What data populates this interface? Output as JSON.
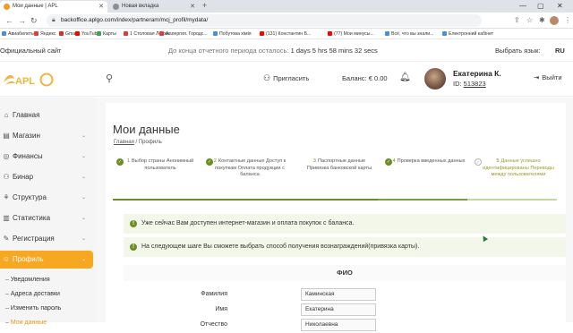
{
  "browser": {
    "tabs": [
      {
        "title": "Мои данные | APL",
        "active": true
      },
      {
        "title": "Новая вкладка",
        "active": false
      }
    ],
    "url": "backoffice.aplgo.com/index/partneram/mcj_profil/mydata/",
    "bookmarks": [
      {
        "label": "Авиабилеты",
        "color": "#4a90d9"
      },
      {
        "label": "Яндекс",
        "color": "#e53935"
      },
      {
        "label": "Gmail",
        "color": "#d93025"
      },
      {
        "label": "YouTube",
        "color": "#ff0000"
      },
      {
        "label": "Карты",
        "color": "#34a853"
      },
      {
        "label": "1 Столовая Ложка...",
        "color": "#e53935"
      },
      {
        "label": "Аллергия. Городс...",
        "color": "#e53935"
      },
      {
        "label": "Побутова хімія",
        "color": "#4a90d9"
      },
      {
        "label": "(131) Константин Б...",
        "color": "#ff0000"
      },
      {
        "label": "(77) Мои минусы...",
        "color": "#ff0000"
      },
      {
        "label": "Всё, что вы знали...",
        "color": "#4a90d9"
      },
      {
        "label": "Електронний кабінет",
        "color": "#4a90d9"
      }
    ]
  },
  "topstrip": {
    "official": "Официальный сайт",
    "countdown_prefix": "До конца отчетного периода осталось: ",
    "countdown_value": "1 days 5 hrs 58 mins 32 secs",
    "lang_label": "Выбрать язык:",
    "lang_value": "RU"
  },
  "header": {
    "logo_text": "APLGO",
    "invite": "Пригласить",
    "balance": "Баланс: € 0.00",
    "user_name": "Екатерина К.",
    "user_id_label": "ID: ",
    "user_id": "513823",
    "logout": "Выйти"
  },
  "sidebar": {
    "items": [
      {
        "label": "Главная",
        "icon": "home-icon",
        "glyph": "⌂",
        "chevron": false
      },
      {
        "label": "Магазин",
        "icon": "shop-icon",
        "glyph": "▤",
        "chevron": true
      },
      {
        "label": "Финансы",
        "icon": "finance-icon",
        "glyph": "◎",
        "chevron": true
      },
      {
        "label": "Бинар",
        "icon": "binar-icon",
        "glyph": "⚇",
        "chevron": true
      },
      {
        "label": "Структура",
        "icon": "structure-icon",
        "glyph": "⚘",
        "chevron": true
      },
      {
        "label": "Статистика",
        "icon": "stats-icon",
        "glyph": "▥",
        "chevron": true
      },
      {
        "label": "Регистрация",
        "icon": "register-icon",
        "glyph": "✎",
        "chevron": true
      },
      {
        "label": "Профиль",
        "icon": "profile-icon",
        "glyph": "☺",
        "chevron": true,
        "active": true
      }
    ],
    "subitems": [
      "Уведомления",
      "Адреса доставки",
      "Изменить пароль",
      "Мои данные"
    ]
  },
  "main": {
    "title": "Мои данные",
    "breadcrumb_home": "Главная",
    "breadcrumb_sep": " / ",
    "breadcrumb_current": "Профиль",
    "steps": [
      {
        "num": "1",
        "text": "Выбор страны Анонимный пользователь",
        "state": "done"
      },
      {
        "num": "2",
        "text": "Контактные данные Доступ к покупкам Оплата продукции с баланса",
        "state": "done"
      },
      {
        "num": "3",
        "text": "Паспортные данные Привязка банковской карты",
        "state": "current"
      },
      {
        "num": "4",
        "text": "Проверка введенных данных",
        "state": "done"
      },
      {
        "num": "5",
        "text": "Данные успешно идентифицированы Переводы между пользователями",
        "state": "pending"
      }
    ],
    "alert1": "Уже сейчас Вам доступен интернет-магазин и оплата покупок с баланса.",
    "alert2": "На следующем шаге Вы сможете выбрать способ получения вознаграждений(привязка карты).",
    "fio_title": "ФИО",
    "form": [
      {
        "label": "Фамилия",
        "value": "Каминская"
      },
      {
        "label": "Имя",
        "value": "Екатерина"
      },
      {
        "label": "Отчество",
        "value": "Николаевна"
      }
    ]
  }
}
